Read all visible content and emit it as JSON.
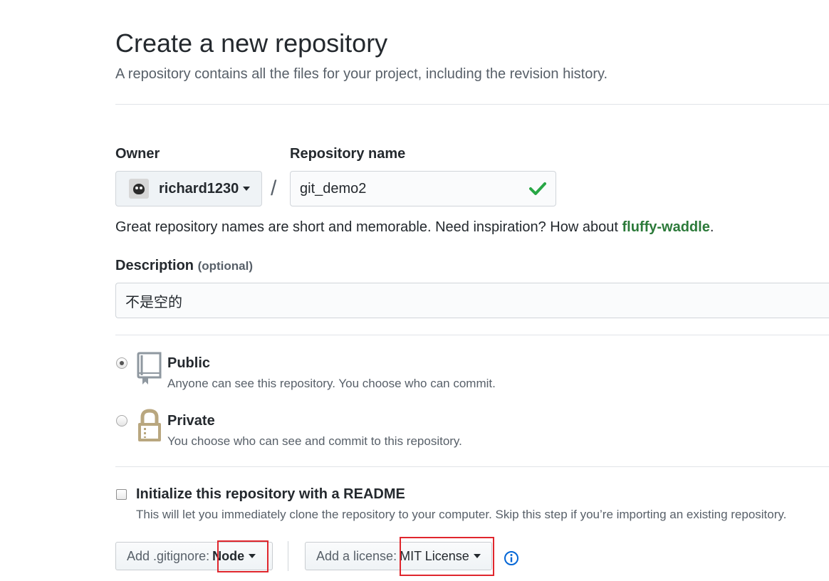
{
  "page": {
    "title": "Create a new repository",
    "subtitle": "A repository contains all the files for your project, including the revision history."
  },
  "owner": {
    "label": "Owner",
    "selected": "richard1230",
    "avatar_icon": "user-avatar"
  },
  "repo_name": {
    "label": "Repository name",
    "value": "git_demo2",
    "valid_icon": "check-icon",
    "valid_color": "#28a745"
  },
  "hint": {
    "text": "Great repository names are short and memorable. Need inspiration? How about ",
    "suggestion": "fluffy-waddle",
    "end": "."
  },
  "description": {
    "label": "Description",
    "optional": "(optional)",
    "value": "不是空的"
  },
  "visibility": {
    "selected": "public",
    "public": {
      "title": "Public",
      "desc": "Anyone can see this repository. You choose who can commit.",
      "icon": "repo-book-icon"
    },
    "private": {
      "title": "Private",
      "desc": "You choose who can see and commit to this repository.",
      "icon": "lock-icon"
    }
  },
  "readme": {
    "checked": false,
    "title": "Initialize this repository with a README",
    "desc": "This will let you immediately clone the repository to your computer. Skip this step if you’re importing an existing repository."
  },
  "gitignore": {
    "label": "Add .gitignore:",
    "value": "Node"
  },
  "license": {
    "label": "Add a license:",
    "value": "MIT License",
    "info_icon": "info-icon"
  },
  "colors": {
    "highlight_box": "#e0262d",
    "link_green": "#2c7a3a",
    "info_blue": "#0366d6"
  }
}
